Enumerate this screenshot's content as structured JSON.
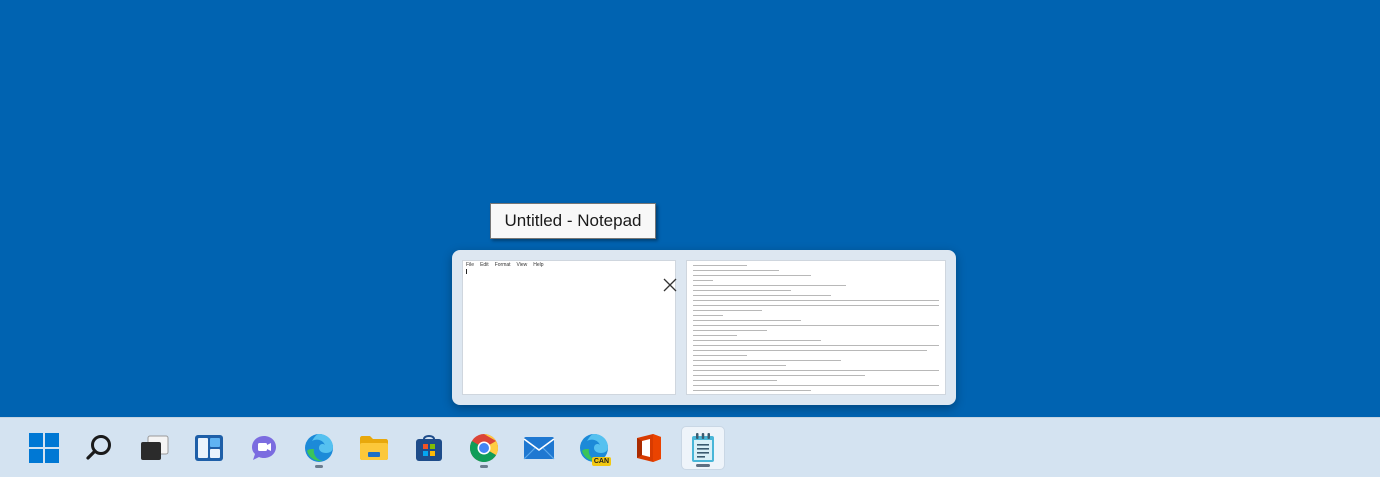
{
  "tooltip": {
    "text": "Untitled - Notepad"
  },
  "thumbnail": {
    "menu": [
      "File",
      "Edit",
      "Format",
      "View",
      "Help"
    ]
  },
  "taskbar": {
    "items": [
      {
        "name": "start",
        "icon": "windows-logo-icon"
      },
      {
        "name": "search",
        "icon": "search-icon"
      },
      {
        "name": "task-view",
        "icon": "task-view-icon"
      },
      {
        "name": "widgets",
        "icon": "widgets-icon"
      },
      {
        "name": "chat",
        "icon": "teams-chat-icon"
      },
      {
        "name": "edge",
        "icon": "edge-icon",
        "running": true
      },
      {
        "name": "file-explorer",
        "icon": "folder-icon"
      },
      {
        "name": "store",
        "icon": "store-icon"
      },
      {
        "name": "chrome",
        "icon": "chrome-icon",
        "running": true
      },
      {
        "name": "mail",
        "icon": "mail-icon"
      },
      {
        "name": "edge-canary",
        "icon": "edge-canary-icon",
        "badge": "CAN"
      },
      {
        "name": "office",
        "icon": "office-icon"
      },
      {
        "name": "notepad",
        "icon": "notepad-icon",
        "running": true,
        "active": true
      }
    ]
  },
  "colors": {
    "desktop": "#0063b1",
    "taskbar": "#d4e3f1",
    "accent": "#0078d4"
  }
}
